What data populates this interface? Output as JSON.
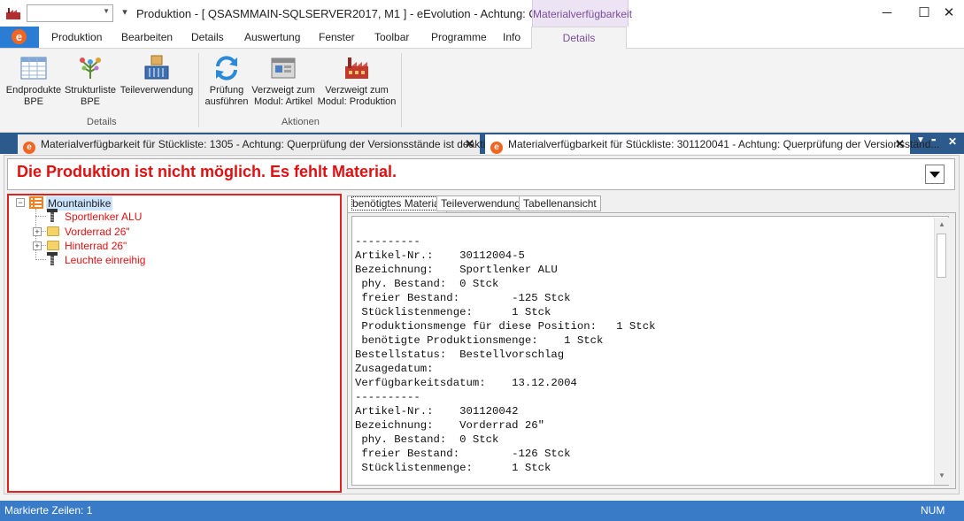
{
  "titlebar": {
    "title": "Produktion - [ QSASMMAIN-SQLSERVER2017, M1 ]  - eEvolution - Achtung: Quer...",
    "context_header": "Materialverfügbarkeit",
    "minimize_icon": "─",
    "maximize_icon": "☐",
    "close_icon": "✕"
  },
  "ribbon_tabs": [
    "Produktion",
    "Bearbeiten",
    "Details",
    "Auswertung",
    "Fenster",
    "Toolbar",
    "Programme",
    "Info"
  ],
  "context_tab": "Details",
  "ribbon": {
    "details_group": {
      "label": "Details",
      "buttons": [
        {
          "line1": "Endprodukte",
          "line2": "BPE",
          "icon": "grid-table-icon"
        },
        {
          "line1": "Strukturliste",
          "line2": "BPE",
          "icon": "structure-tree-icon"
        },
        {
          "line1": "Teileverwendung",
          "line2": "",
          "icon": "parts-usage-icon"
        }
      ]
    },
    "actions_group": {
      "label": "Aktionen",
      "buttons": [
        {
          "line1": "Prüfung",
          "line2": "ausführen",
          "icon": "refresh-icon"
        },
        {
          "line1": "Verzweigt zum",
          "line2": "Modul: Artikel",
          "icon": "article-module-icon"
        },
        {
          "line1": "Verzweigt zum",
          "line2": "Modul: Produktion",
          "icon": "factory-icon"
        }
      ]
    }
  },
  "doc_tabs": [
    {
      "title": "Materialverfügbarkeit für Stückliste: 1305 - Achtung: Querprüfung der Versionsstände ist deaktiviert!",
      "close": "✕"
    },
    {
      "title": "Materialverfügbarkeit für Stückliste: 301120041 - Achtung: Querprüfung der Versionsständ...",
      "close": "✕"
    }
  ],
  "doc_tab_controls": {
    "menu": "▼",
    "float": "▪▪",
    "close": "✕"
  },
  "error_message": "Die Produktion ist nicht möglich. Es fehlt Material.",
  "tree": {
    "root": {
      "label": "Mountainbike",
      "expander": "−"
    },
    "children": [
      {
        "label": "Sportlenker ALU",
        "type": "part",
        "expander": ""
      },
      {
        "label": "Vorderrad 26\"",
        "type": "folder",
        "expander": "+"
      },
      {
        "label": "Hinterrad 26\"",
        "type": "folder",
        "expander": "+"
      },
      {
        "label": "Leuchte einreihig",
        "type": "part",
        "expander": ""
      }
    ],
    "child_color": "#e01010"
  },
  "detail_tabs": [
    "benötigtes Material",
    "Teileverwendung",
    "Tabellenansicht"
  ],
  "detail_text": "----------\nArtikel-Nr.:    30112004-5\nBezeichnung:    Sportlenker ALU\n phy. Bestand:  0 Stck\n freier Bestand:        -125 Stck\n Stücklistenmenge:      1 Stck\n Produktionsmenge für diese Position:   1 Stck\n benötigte Produktionsmenge:    1 Stck\nBestellstatus:  Bestellvorschlag\nZusagedatum:\nVerfügbarkeitsdatum:    13.12.2004\n----------\nArtikel-Nr.:    301120042\nBezeichnung:    Vorderrad 26\"\n phy. Bestand:  0 Stck\n freier Bestand:        -126 Stck\n Stücklistenmenge:      1 Stck",
  "status": {
    "left": "Markierte Zeilen: 1",
    "right": "NUM"
  },
  "colors": {
    "accent": "#2b7cd3",
    "context": "#7a4d9c",
    "error": "#e01010",
    "statusbar": "#3a7bc8",
    "doctabbar": "#2c5a8c"
  }
}
